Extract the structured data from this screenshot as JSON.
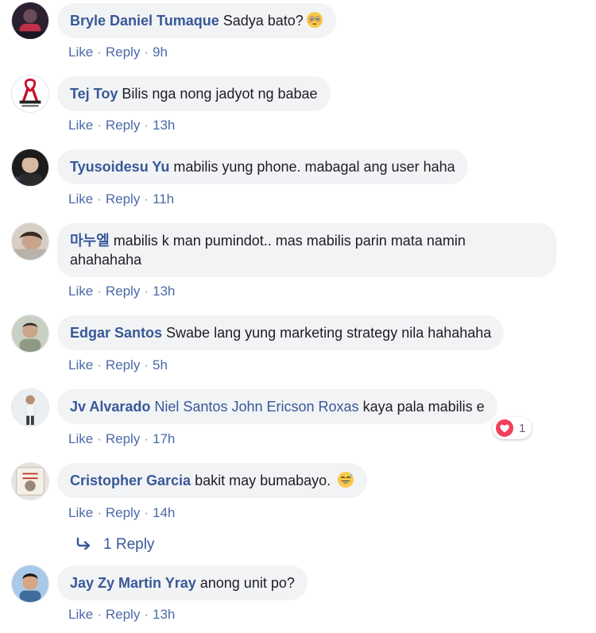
{
  "colors": {
    "bubble_bg": "#f2f3f5",
    "author_link": "#385898",
    "action_link": "#4b6aa8",
    "text": "#1c1e21",
    "reaction_heart": "#f33e58"
  },
  "actions": {
    "like": "Like",
    "reply": "Reply",
    "separator": "·"
  },
  "comments": [
    {
      "author": "Bryle Daniel Tumaque",
      "text": "Sadya bato?",
      "emoji": "flushed-face-emoji",
      "time": "9h"
    },
    {
      "author": "Tej Toy",
      "text": "Bilis nga nong jadyot ng babae",
      "time": "13h"
    },
    {
      "author": "Tyusoidesu Yu",
      "text": "mabilis yung phone. mabagal ang user haha",
      "time": "11h"
    },
    {
      "author": "마누엘",
      "text_line1": "mabilis k man pumindot.. mas mabilis parin mata namin",
      "text_line2": "ahahahaha",
      "time": "13h"
    },
    {
      "author": "Edgar Santos",
      "text": "Swabe lang yung marketing strategy nila hahahaha",
      "time": "5h"
    },
    {
      "author": "Jv Alvarado",
      "mentions": [
        "Niel Santos",
        "John Ericson Roxas"
      ],
      "text": "kaya pala mabilis e",
      "time": "17h",
      "reaction": {
        "icon": "love-heart-icon",
        "count": "1"
      }
    },
    {
      "author": "Cristopher Garcia",
      "text": "bakit may bumabayo.",
      "emoji": "grinning-sweat-emoji",
      "time": "14h",
      "replies_label": "1 Reply"
    },
    {
      "author": "Jay Zy Martin Yray",
      "text": "anong unit po?",
      "time": "13h"
    }
  ]
}
